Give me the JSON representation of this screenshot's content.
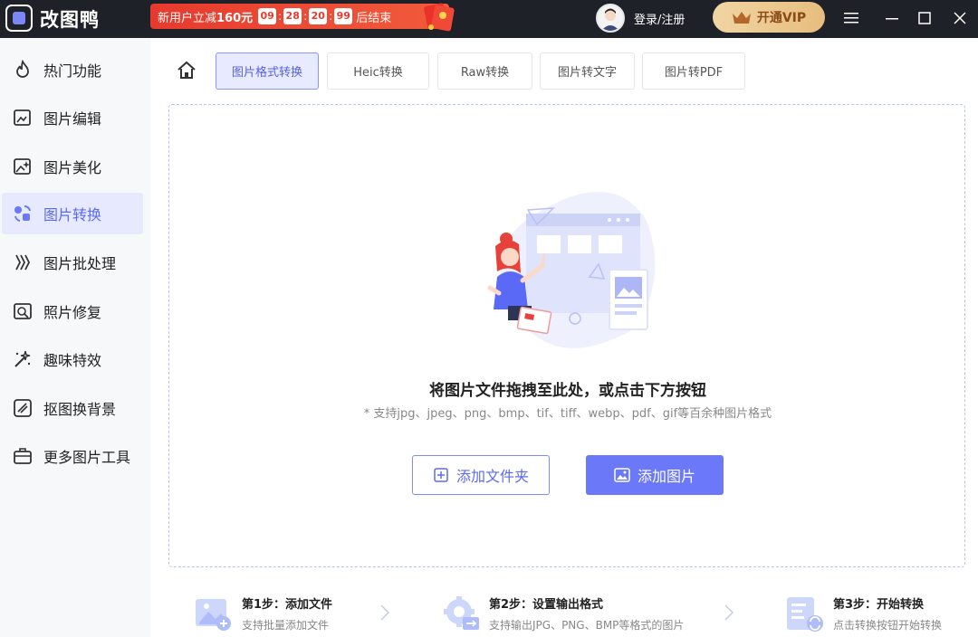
{
  "app": {
    "name": "改图鸭"
  },
  "promo": {
    "text_prefix": "新用户立减",
    "amount": "160元",
    "timer": [
      "09",
      "28",
      "20",
      "99"
    ],
    "text_suffix": "后结束"
  },
  "account": {
    "login_label": "登录/注册",
    "vip_label": "开通VIP"
  },
  "sidebar": {
    "items": [
      {
        "label": "热门功能",
        "icon": "fire-icon"
      },
      {
        "label": "图片编辑",
        "icon": "image-edit-icon"
      },
      {
        "label": "图片美化",
        "icon": "image-beautify-icon"
      },
      {
        "label": "图片转换",
        "icon": "image-convert-icon",
        "active": true
      },
      {
        "label": "图片批处理",
        "icon": "batch-icon"
      },
      {
        "label": "照片修复",
        "icon": "photo-repair-icon"
      },
      {
        "label": "趣味特效",
        "icon": "magic-icon"
      },
      {
        "label": "抠图换背景",
        "icon": "cutout-icon"
      },
      {
        "label": "更多图片工具",
        "icon": "toolbox-icon"
      }
    ]
  },
  "tabs": [
    {
      "label": "图片格式转换",
      "active": true
    },
    {
      "label": "Heic转换"
    },
    {
      "label": "Raw转换"
    },
    {
      "label": "图片转文字"
    },
    {
      "label": "图片转PDF"
    }
  ],
  "dropzone": {
    "title": "将图片文件拖拽至此处，或点击下方按钮",
    "subtitle": "* 支持jpg、jpeg、png、bmp、tif、tiff、webp、pdf、gif等百余种图片格式",
    "add_folder_label": "添加文件夹",
    "add_image_label": "添加图片"
  },
  "steps": [
    {
      "title": "第1步：添加文件",
      "desc": "支持批量添加文件"
    },
    {
      "title": "第2步：设置输出格式",
      "desc": "支持输出JPG、PNG、BMP等格式的图片"
    },
    {
      "title": "第3步：开始转换",
      "desc": "点击转换按钮开始转换"
    }
  ],
  "colors": {
    "accent": "#6b78f8",
    "titlebar": "#1e2127",
    "promo": "#e63a2e",
    "vip": "#e6bd7d"
  }
}
